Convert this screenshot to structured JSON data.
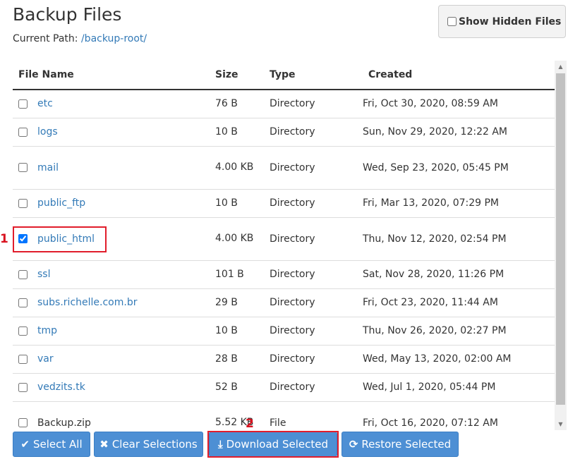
{
  "header": {
    "title": "Backup Files",
    "current_path_label": "Current Path:",
    "current_path_value": "/backup-root/",
    "show_hidden_label": "Show Hidden Files"
  },
  "table": {
    "columns": [
      "File Name",
      "Size",
      "Type",
      "Created"
    ],
    "rows": [
      {
        "name": "etc",
        "size": "76 B",
        "type": "Directory",
        "created": "Fri, Oct 30, 2020, 08:59 AM",
        "checked": false
      },
      {
        "name": "logs",
        "size": "10 B",
        "type": "Directory",
        "created": "Sun, Nov 29, 2020, 12:22 AM",
        "checked": false
      },
      {
        "name": "mail",
        "size": "4.00 KB",
        "type": "Directory",
        "created": "Wed, Sep 23, 2020, 05:45 PM",
        "checked": false
      },
      {
        "name": "public_ftp",
        "size": "10 B",
        "type": "Directory",
        "created": "Fri, Mar 13, 2020, 07:29 PM",
        "checked": false
      },
      {
        "name": "public_html",
        "size": "4.00 KB",
        "type": "Directory",
        "created": "Thu, Nov 12, 2020, 02:54 PM",
        "checked": true
      },
      {
        "name": "ssl",
        "size": "101 B",
        "type": "Directory",
        "created": "Sat, Nov 28, 2020, 11:26 PM",
        "checked": false
      },
      {
        "name": "subs.richelle.com.br",
        "size": "29 B",
        "type": "Directory",
        "created": "Fri, Oct 23, 2020, 11:44 AM",
        "checked": false
      },
      {
        "name": "tmp",
        "size": "10 B",
        "type": "Directory",
        "created": "Thu, Nov 26, 2020, 02:27 PM",
        "checked": false
      },
      {
        "name": "var",
        "size": "28 B",
        "type": "Directory",
        "created": "Wed, May 13, 2020, 02:00 AM",
        "checked": false
      },
      {
        "name": "vedzits.tk",
        "size": "52 B",
        "type": "Directory",
        "created": "Wed, Jul 1, 2020, 05:44 PM",
        "checked": false
      },
      {
        "name": "Backup.zip",
        "size": "5.52 KB",
        "type": "File",
        "created": "Fri, Oct 16, 2020, 07:12 AM",
        "checked": false
      }
    ]
  },
  "actions": {
    "select_all": "Select All",
    "clear_selections": "Clear Selections",
    "download_selected": "Download Selected",
    "restore_selected": "Restore Selected"
  },
  "annotations": {
    "marker_1": "1",
    "marker_2": "2"
  },
  "colors": {
    "link": "#337ab7",
    "button": "#4d8fd4",
    "highlight": "#e11d2b"
  }
}
